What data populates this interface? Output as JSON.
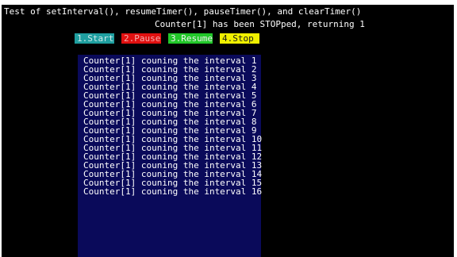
{
  "header": {
    "title": "Test of setInterval(), resumeTimer(), pauseTimer(), and clearTimer()",
    "status": "Counter[1] has been STOPped, returning 1"
  },
  "buttons": {
    "start": "1.Start",
    "pause": "2.Pause",
    "resume": "3.Resume",
    "stop": "4.Stop"
  },
  "colors": {
    "screen_bg": "#000000",
    "panel_bg": "#0a0a5a",
    "start": "#1f9fa0",
    "pause": "#e01010",
    "resume": "#22c82a",
    "stop": "#f0f000"
  },
  "log": [
    "Counter[1] couning the interval 1",
    "Counter[1] couning the interval 2",
    "Counter[1] couning the interval 3",
    "Counter[1] couning the interval 4",
    "Counter[1] couning the interval 5",
    "Counter[1] couning the interval 6",
    "Counter[1] couning the interval 7",
    "Counter[1] couning the interval 8",
    "Counter[1] couning the interval 9",
    "Counter[1] couning the interval 10",
    "Counter[1] couning the interval 11",
    "Counter[1] couning the interval 12",
    "Counter[1] couning the interval 13",
    "Counter[1] couning the interval 14",
    "Counter[1] couning the interval 15",
    "Counter[1] couning the interval 16"
  ]
}
